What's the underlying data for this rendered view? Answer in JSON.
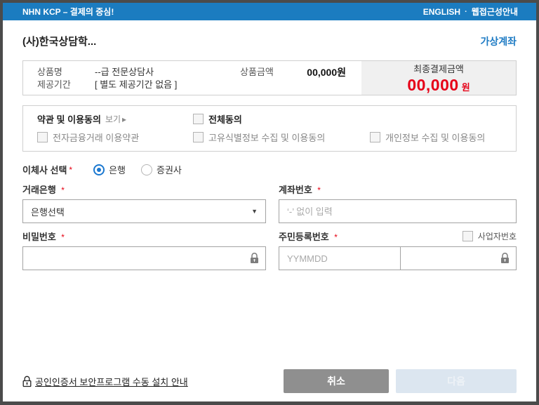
{
  "header": {
    "title": "NHN KCP – 결제의 중심!",
    "links": [
      "ENGLISH",
      "웹접근성안내"
    ],
    "separator": "·"
  },
  "page": {
    "merchant_title": "(사)한국상담학...",
    "virtual_account_link": "가상계좌"
  },
  "order": {
    "product_name_label": "상품명",
    "product_name": "--급 전문상담사",
    "amount_label": "상품금액",
    "amount": "00,000원",
    "period_label": "제공기간",
    "period": "[ 별도 제공기간 없음 ]",
    "total_label": "최종결제금액",
    "total_amount": "00,000",
    "total_currency": "원"
  },
  "terms": {
    "title": "약관 및 이용동의",
    "view_label": "보기",
    "view_arrow": "▸",
    "agree_all_label": "전체동의",
    "items": [
      "전자금융거래 이용약관",
      "고유식별정보 수집 및 이용동의",
      "개인정보 수집 및 이용동의"
    ]
  },
  "transfer": {
    "label": "이체사 선택",
    "required_mark": "*",
    "options": [
      {
        "label": "은행",
        "selected": true
      },
      {
        "label": "증권사",
        "selected": false
      }
    ]
  },
  "form": {
    "bank": {
      "label": "거래은행",
      "value": "은행선택",
      "caret": "▼"
    },
    "account": {
      "label": "계좌번호",
      "placeholder": "‘-’ 없이 입력"
    },
    "password": {
      "label": "비밀번호"
    },
    "rrn": {
      "label": "주민등록번호",
      "business_checkbox_label": "사업자번호",
      "placeholder": "YYMMDD"
    }
  },
  "footer": {
    "guide_link": "공인인증서 보안프로그램 수동 설치 안내",
    "cancel_label": "취소",
    "next_label": "다음"
  },
  "colors": {
    "header_blue": "#1b7cc0",
    "link_blue": "#1e7bc4",
    "price_red": "#e60017",
    "required_red": "#e60012",
    "cancel_gray": "#8f8f8f",
    "next_disabled_bg": "#dce6f0",
    "panel_gray": "#f0f0f0",
    "box_border": "#cfcfcf"
  }
}
